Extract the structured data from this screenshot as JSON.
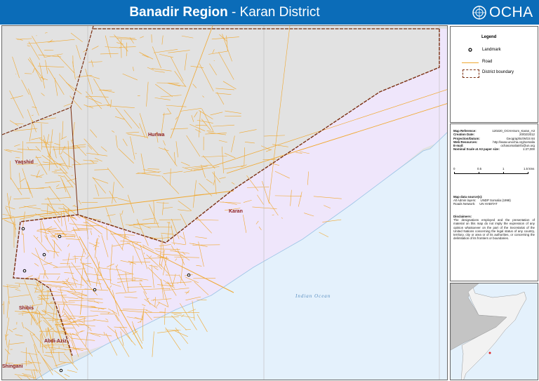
{
  "header": {
    "title_bold": "Banadir Region",
    "title_sep": " - ",
    "title_rest": "Karan District",
    "org": "OCHA"
  },
  "legend": {
    "title": "Legend",
    "items": [
      {
        "label": "Landmark"
      },
      {
        "label": "Road"
      },
      {
        "label": "District boundary"
      }
    ]
  },
  "info": {
    "rows": [
      {
        "k": "Map Reference:",
        "v": "120220_OCHASom_Karan_A3"
      },
      {
        "k": "Creation Date:",
        "v": "20/02/2012"
      },
      {
        "k": "Projection/Datum:",
        "v": "Geographic/WGS 84"
      },
      {
        "k": "Web Resources:",
        "v": "http://www.unocha.org/somalia"
      },
      {
        "k": "E-mail:",
        "v": "ochasomaliainfo@un.org"
      },
      {
        "k": "Nominal Scale at A3 paper size:",
        "v": "1:27,000"
      }
    ],
    "scale": [
      "0",
      "0.5",
      "1",
      "1.5 kms"
    ],
    "sources_title": "Map data source(s):",
    "sources": [
      {
        "k": "All Admin layers:",
        "v": "UNDP Somalia (1998)"
      },
      {
        "k": "Roads Network:",
        "v": "UN HABITAT"
      }
    ],
    "disclaimer_title": "Disclaimers:",
    "disclaimer": "The designations employed and the presentation of material on this map do not imply the expression of any opinion whatsoever on the part of the Secretariat of the United Nations concerning the legal status of any country, territory, city or area or of its authorities, or concerning the delimitation of its frontiers or boundaries."
  },
  "map": {
    "districts": [
      "Hurlwa",
      "Yaqshid",
      "Karan",
      "Shibis",
      "Abdi-Aziz",
      "Shingani"
    ],
    "sea_label": "Indian Ocean",
    "colors": {
      "land": "#e2e2e2",
      "district": "#efe6fb",
      "sea": "#e4f1fc",
      "road": "#f0a830",
      "boundary": "#7a2e10",
      "header": "#0b6cb8"
    }
  }
}
